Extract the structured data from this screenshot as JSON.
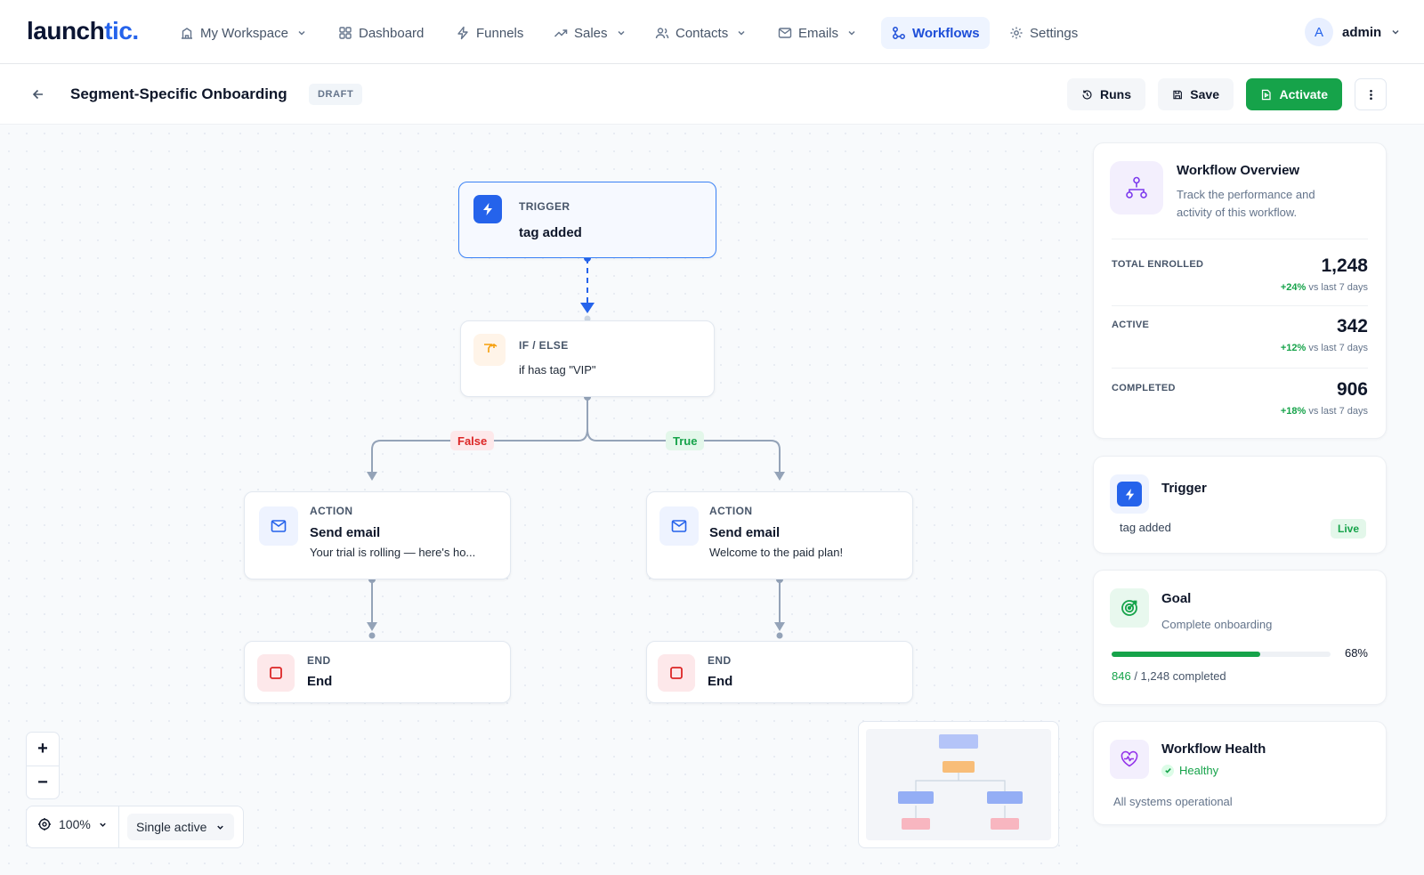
{
  "brand": {
    "name_a": "launch",
    "name_b": "tic."
  },
  "nav": {
    "items": [
      {
        "label": "My Workspace",
        "icon": "building-icon"
      },
      {
        "label": "Dashboard",
        "icon": "grid-icon"
      },
      {
        "label": "Funnels",
        "icon": "lightning-icon"
      },
      {
        "label": "Sales",
        "icon": "trend-up-icon"
      },
      {
        "label": "Contacts",
        "icon": "users-icon"
      },
      {
        "label": "Emails",
        "icon": "mail-icon"
      },
      {
        "label": "Workflows",
        "icon": "workflow-icon",
        "active": true
      },
      {
        "label": "Settings",
        "icon": "gear-icon"
      }
    ],
    "user": {
      "initial": "A",
      "name": "admin"
    }
  },
  "header": {
    "title": "Segment-Specific Onboarding",
    "status": "DRAFT",
    "runs_label": "Runs",
    "save_label": "Save",
    "activate_label": "Activate"
  },
  "flow": {
    "trigger": {
      "kind": "TRIGGER",
      "title": "tag added"
    },
    "condition": {
      "kind": "IF / ELSE",
      "text": "if has tag \"VIP\""
    },
    "branch_false": "False",
    "branch_true": "True",
    "action_left": {
      "kind": "ACTION",
      "title": "Send email",
      "subtitle": "Your trial is rolling — here's ho..."
    },
    "action_right": {
      "kind": "ACTION",
      "title": "Send email",
      "subtitle": "Welcome to the paid plan!"
    },
    "end_left": {
      "kind": "END",
      "title": "End"
    },
    "end_right": {
      "kind": "END",
      "title": "End"
    }
  },
  "controls": {
    "zoom_in": "+",
    "zoom_out": "−",
    "zoom_level": "100%",
    "mode": "Single active"
  },
  "overview": {
    "title": "Workflow Overview",
    "description": "Track the performance and activity of this workflow.",
    "stats": [
      {
        "label": "TOTAL ENROLLED",
        "value": "1,248",
        "delta": "+24%",
        "period": "vs last 7 days"
      },
      {
        "label": "ACTIVE",
        "value": "342",
        "delta": "+12%",
        "period": "vs last 7 days"
      },
      {
        "label": "COMPLETED",
        "value": "906",
        "delta": "+18%",
        "period": "vs last 7 days"
      }
    ]
  },
  "trigger_card": {
    "title": "Trigger",
    "value": "tag added",
    "badge": "Live"
  },
  "goal_card": {
    "title": "Goal",
    "description": "Complete onboarding",
    "progress": 0.68,
    "percent_label": "68%",
    "completed": "846",
    "total_label": " / 1,248 completed"
  },
  "health_card": {
    "title": "Workflow Health",
    "status": "Healthy",
    "note": "All systems operational"
  },
  "colors": {
    "accent": "#2563eb",
    "success": "#16a34a",
    "danger": "#dc2626",
    "warning": "#f59e0b"
  }
}
